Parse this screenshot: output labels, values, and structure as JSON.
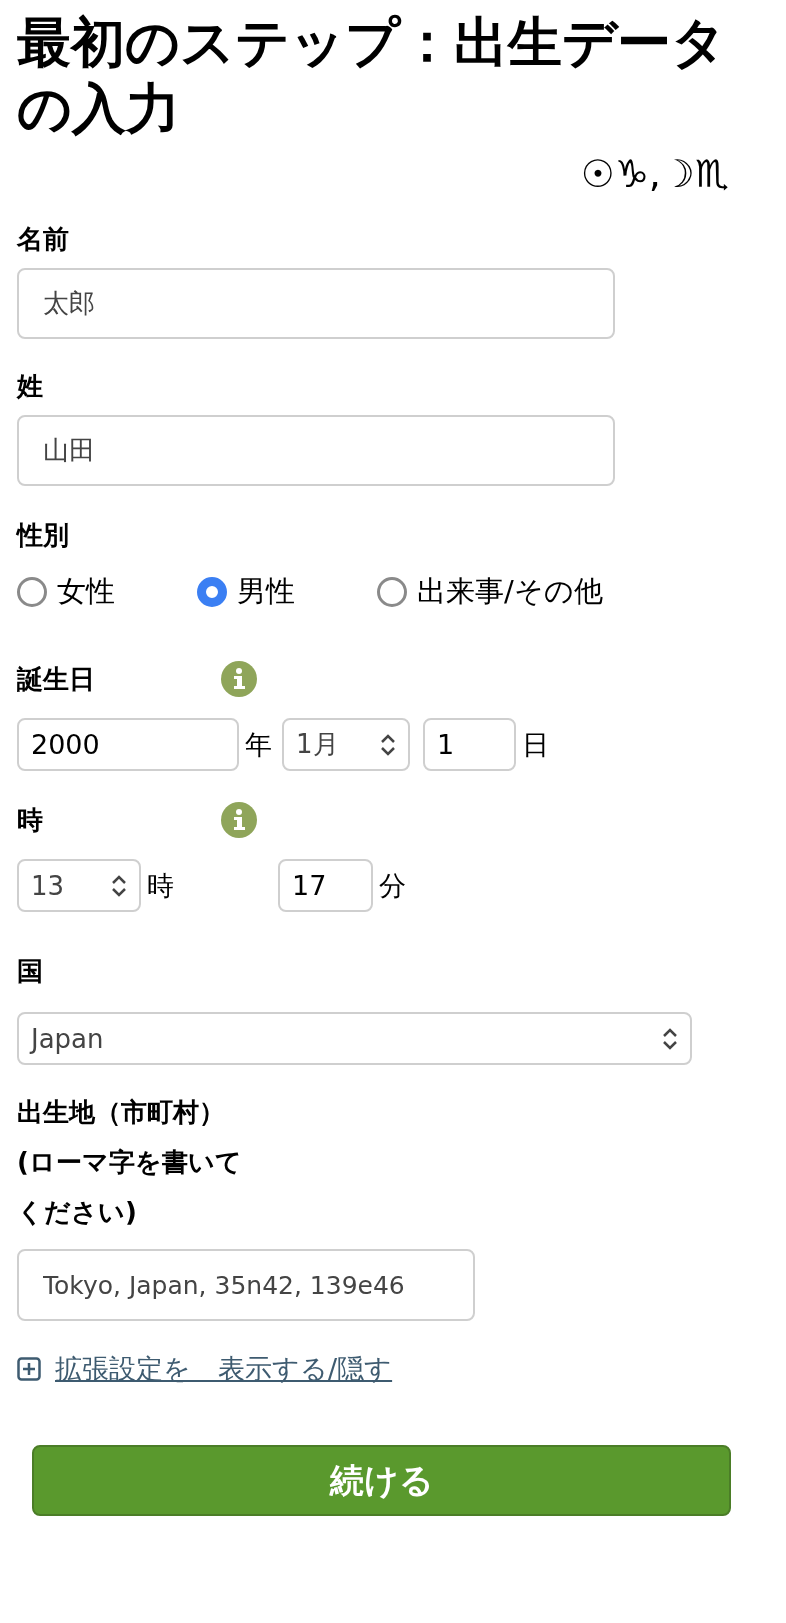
{
  "title": "最初のステップ：出生データの入力",
  "zodiac_line": "☉♑,☽♏",
  "name": {
    "label": "名前",
    "value": "太郎"
  },
  "surname": {
    "label": "姓",
    "value": "山田"
  },
  "gender": {
    "label": "性別",
    "options": [
      {
        "label": "女性",
        "selected": false
      },
      {
        "label": "男性",
        "selected": true
      },
      {
        "label": "出来事/その他",
        "selected": false
      }
    ]
  },
  "birth_date": {
    "label": "誕生日",
    "year": "2000",
    "year_unit": "年",
    "month": "1月",
    "day": "1",
    "day_unit": "日"
  },
  "birth_time": {
    "label": "時",
    "hour": "13",
    "hour_unit": "時",
    "minute": "17",
    "minute_unit": "分"
  },
  "country": {
    "label": "国",
    "value": "Japan"
  },
  "birthplace": {
    "label": "出生地（市町村）(ローマ字を書いてください)",
    "value": "Tokyo, Japan, 35n42, 139e46"
  },
  "advanced_link": "拡張設定を　表示する/隠す",
  "continue_button": "続ける"
}
